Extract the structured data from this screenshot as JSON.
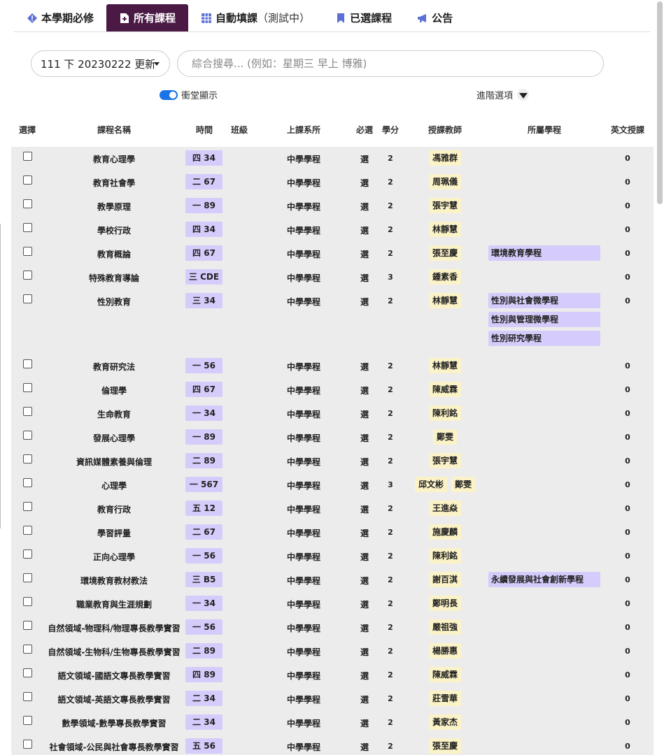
{
  "tabs": [
    {
      "label": "本學期必修",
      "sub": "",
      "icon": "alert-icon",
      "active": false
    },
    {
      "label": "所有課程",
      "sub": "",
      "icon": "file-icon",
      "active": true
    },
    {
      "label": "自動填課",
      "sub": "（測試中）",
      "icon": "table-icon",
      "active": false
    },
    {
      "label": "已選課程",
      "sub": "",
      "icon": "bookmark-icon",
      "active": false
    },
    {
      "label": "公告",
      "sub": "",
      "icon": "megaphone-icon",
      "active": false
    }
  ],
  "semester_select": {
    "value": "111 下 20230222 更新"
  },
  "search": {
    "placeholder": "綜合搜尋... (例如：星期三 早上 博雅)",
    "value": ""
  },
  "toggle": {
    "label": "衝堂顯示",
    "on": true
  },
  "advanced": {
    "label": "進階選項"
  },
  "columns": {
    "select": "選擇",
    "name": "課程名稱",
    "time": "時間",
    "class": "班級",
    "dept": "上課系所",
    "required": "必選",
    "credits": "學分",
    "teacher": "授課教師",
    "program": "所屬學程",
    "english": "英文授課"
  },
  "courses": [
    {
      "name": "教育心理學",
      "time": "四 34",
      "dept": "中學學程",
      "req": "選",
      "credits": "2",
      "teachers": [
        "馮雅群"
      ],
      "programs": [],
      "eng": "0"
    },
    {
      "name": "教育社會學",
      "time": "二 67",
      "dept": "中學學程",
      "req": "選",
      "credits": "2",
      "teachers": [
        "周珮儀"
      ],
      "programs": [],
      "eng": "0"
    },
    {
      "name": "教學原理",
      "time": "一 89",
      "dept": "中學學程",
      "req": "選",
      "credits": "2",
      "teachers": [
        "張宇慧"
      ],
      "programs": [],
      "eng": "0"
    },
    {
      "name": "學校行政",
      "time": "四 34",
      "dept": "中學學程",
      "req": "選",
      "credits": "2",
      "teachers": [
        "林靜慧"
      ],
      "programs": [],
      "eng": "0"
    },
    {
      "name": "教育概論",
      "time": "四 67",
      "dept": "中學學程",
      "req": "選",
      "credits": "2",
      "teachers": [
        "張至慶"
      ],
      "programs": [
        "環境教育學程"
      ],
      "eng": "0"
    },
    {
      "name": "特殊教育導論",
      "time": "三 CDE",
      "dept": "中學學程",
      "req": "選",
      "credits": "3",
      "teachers": [
        "鍾素香"
      ],
      "programs": [],
      "eng": "0"
    },
    {
      "name": "性別教育",
      "time": "三 34",
      "dept": "中學學程",
      "req": "選",
      "credits": "2",
      "teachers": [
        "林靜慧"
      ],
      "programs": [
        "性別與社會微學程",
        "性別與管理微學程",
        "性別研究學程"
      ],
      "eng": "0"
    },
    {
      "name": "教育研究法",
      "time": "一 56",
      "dept": "中學學程",
      "req": "選",
      "credits": "2",
      "teachers": [
        "林靜慧"
      ],
      "programs": [],
      "eng": "0"
    },
    {
      "name": "倫理學",
      "time": "四 67",
      "dept": "中學學程",
      "req": "選",
      "credits": "2",
      "teachers": [
        "陳威霖"
      ],
      "programs": [],
      "eng": "0"
    },
    {
      "name": "生命教育",
      "time": "一 34",
      "dept": "中學學程",
      "req": "選",
      "credits": "2",
      "teachers": [
        "陳利銘"
      ],
      "programs": [],
      "eng": "0"
    },
    {
      "name": "發展心理學",
      "time": "一 89",
      "dept": "中學學程",
      "req": "選",
      "credits": "2",
      "teachers": [
        "鄭雯"
      ],
      "programs": [],
      "eng": "0"
    },
    {
      "name": "資訊媒體素養與倫理",
      "time": "二 89",
      "dept": "中學學程",
      "req": "選",
      "credits": "2",
      "teachers": [
        "張宇慧"
      ],
      "programs": [],
      "eng": "0"
    },
    {
      "name": "心理學",
      "time": "一 567",
      "dept": "中學學程",
      "req": "選",
      "credits": "3",
      "teachers": [
        "邱文彬",
        "鄭雯"
      ],
      "programs": [],
      "eng": "0"
    },
    {
      "name": "教育行政",
      "time": "五 12",
      "dept": "中學學程",
      "req": "選",
      "credits": "2",
      "teachers": [
        "王進焱"
      ],
      "programs": [],
      "eng": "0"
    },
    {
      "name": "學習評量",
      "time": "二 67",
      "dept": "中學學程",
      "req": "選",
      "credits": "2",
      "teachers": [
        "施慶麟"
      ],
      "programs": [],
      "eng": "0"
    },
    {
      "name": "正向心理學",
      "time": "一 56",
      "dept": "中學學程",
      "req": "選",
      "credits": "2",
      "teachers": [
        "陳利銘"
      ],
      "programs": [],
      "eng": "0"
    },
    {
      "name": "環境教育教材教法",
      "time": "三 B5",
      "dept": "中學學程",
      "req": "選",
      "credits": "2",
      "teachers": [
        "謝百淇"
      ],
      "programs": [
        "永續發展與社會創新學程"
      ],
      "eng": "0"
    },
    {
      "name": "職業教育與生涯規劃",
      "time": "一 34",
      "dept": "中學學程",
      "req": "選",
      "credits": "2",
      "teachers": [
        "鄭明長"
      ],
      "programs": [],
      "eng": "0"
    },
    {
      "name": "自然領域-物理科/物理專長教學實習",
      "time": "一 56",
      "dept": "中學學程",
      "req": "選",
      "credits": "2",
      "teachers": [
        "嚴祖強"
      ],
      "programs": [],
      "eng": "0"
    },
    {
      "name": "自然領域-生物科/生物專長教學實習",
      "time": "二 89",
      "dept": "中學學程",
      "req": "選",
      "credits": "2",
      "teachers": [
        "楊勝惠"
      ],
      "programs": [],
      "eng": "0"
    },
    {
      "name": "語文領域-國語文專長教學實習",
      "time": "四 89",
      "dept": "中學學程",
      "req": "選",
      "credits": "2",
      "teachers": [
        "陳威霖"
      ],
      "programs": [],
      "eng": "0"
    },
    {
      "name": "語文領域-英語文專長教學實習",
      "time": "二 34",
      "dept": "中學學程",
      "req": "選",
      "credits": "2",
      "teachers": [
        "莊雪華"
      ],
      "programs": [],
      "eng": "0"
    },
    {
      "name": "數學領域-數學專長教學實習",
      "time": "二 34",
      "dept": "中學學程",
      "req": "選",
      "credits": "2",
      "teachers": [
        "黃家杰"
      ],
      "programs": [],
      "eng": "0"
    },
    {
      "name": "社會領域-公民與社會專長教學實習",
      "time": "五 56",
      "dept": "中學學程",
      "req": "選",
      "credits": "2",
      "teachers": [
        "張至慶"
      ],
      "programs": [],
      "eng": "0"
    }
  ]
}
